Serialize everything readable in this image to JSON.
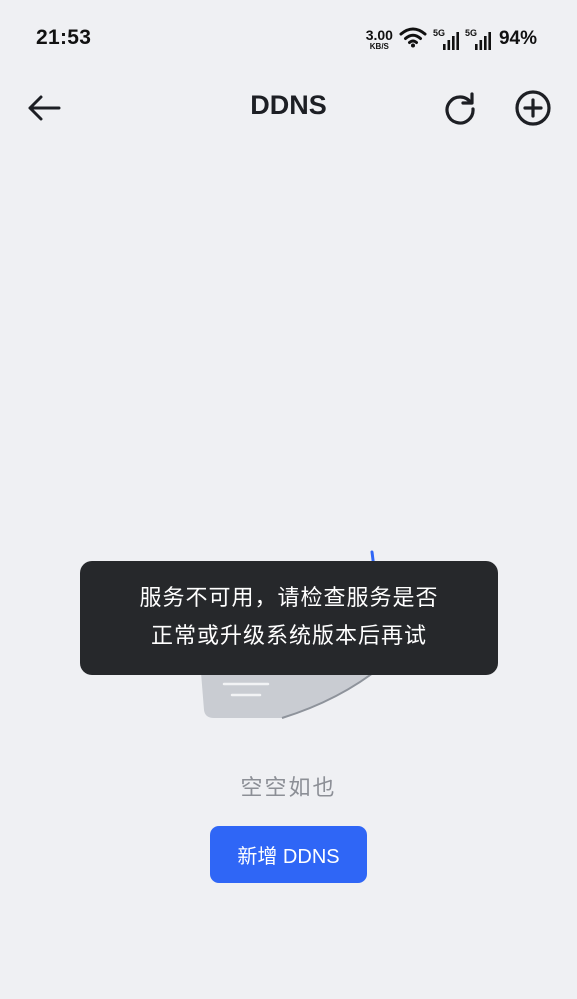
{
  "status_bar": {
    "time": "21:53",
    "net_speed_value": "3.00",
    "net_speed_unit": "KB/S",
    "sim1_tag": "5G",
    "sim2_tag": "5G",
    "battery": "94%",
    "icons": [
      "wifi-icon",
      "signal-icon",
      "signal-icon"
    ]
  },
  "app_bar": {
    "title": "DDNS",
    "icons": [
      "arrow-left-icon",
      "refresh-icon",
      "plus-circle-icon"
    ]
  },
  "main": {
    "empty_text": "空空如也",
    "add_button_label": "新增 DDNS"
  },
  "toast": {
    "line1": "服务不可用，请检查服务是否",
    "line2": "正常或升级系统版本后再试"
  },
  "colors": {
    "background": "#eff0f3",
    "accent": "#2f66f6",
    "toast_bg": "#26282b",
    "muted_text": "#8c8f96"
  }
}
